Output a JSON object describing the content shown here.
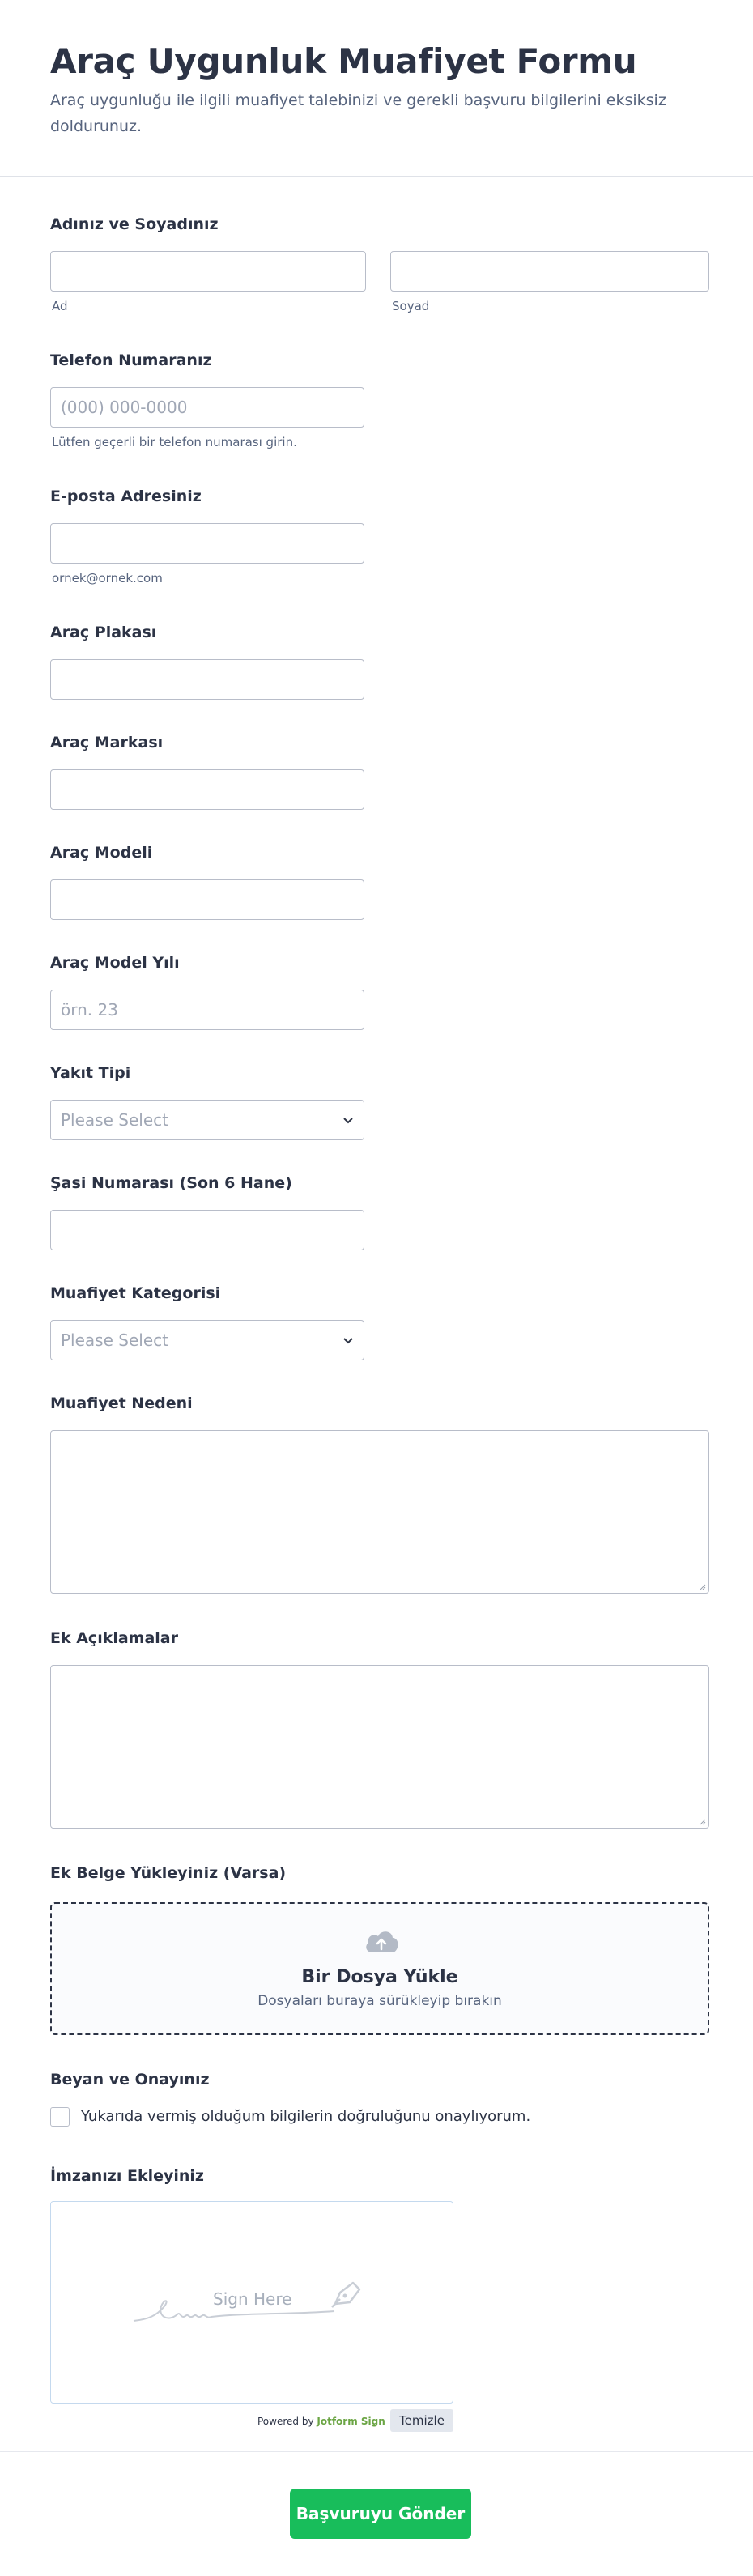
{
  "header": {
    "title": "Araç Uygunluk Muafiyet Formu",
    "subtitle": "Araç uygunluğu ile ilgili muafiyet talebinizi ve gerekli başvuru bilgilerini eksiksiz doldurunuz."
  },
  "fields": {
    "name": {
      "label": "Adınız ve Soyadınız",
      "first_sub": "Ad",
      "last_sub": "Soyad",
      "first_value": "",
      "last_value": ""
    },
    "phone": {
      "label": "Telefon Numaranız",
      "placeholder": "(000) 000-0000",
      "sub": "Lütfen geçerli bir telefon numarası girin."
    },
    "email": {
      "label": "E-posta Adresiniz",
      "sub": "ornek@ornek.com",
      "value": ""
    },
    "plate": {
      "label": "Araç Plakası",
      "value": ""
    },
    "brand": {
      "label": "Araç Markası",
      "value": ""
    },
    "model": {
      "label": "Araç Modeli",
      "value": ""
    },
    "year": {
      "label": "Araç Model Yılı",
      "placeholder": "örn. 23"
    },
    "fuel": {
      "label": "Yakıt Tipi",
      "selected": "Please Select"
    },
    "chassis": {
      "label": "Şasi Numarası (Son 6 Hane)",
      "value": ""
    },
    "category": {
      "label": "Muafiyet Kategorisi",
      "selected": "Please Select"
    },
    "reason": {
      "label": "Muafiyet Nedeni",
      "value": ""
    },
    "notes": {
      "label": "Ek Açıklamalar",
      "value": ""
    },
    "upload": {
      "label": "Ek Belge Yükleyiniz (Varsa)",
      "title": "Bir Dosya Yükle",
      "hint": "Dosyaları buraya sürükleyip bırakın"
    },
    "consent": {
      "label": "Beyan ve Onayınız",
      "text": "Yukarıda vermiş olduğum bilgilerin doğruluğunu onaylıyorum."
    },
    "signature": {
      "label": "İmzanızı Ekleyiniz",
      "placeholder": "Sign Here",
      "powered_prefix": "Powered by",
      "powered_brand": "Jotform Sign",
      "clear_label": "Temizle"
    }
  },
  "submit_label": "Başvuruyu Gönder",
  "colors": {
    "accent": "#18bd5b",
    "text": "#2c3345",
    "muted": "#57647e",
    "border": "#b8bdc9"
  },
  "icons": {
    "select": "chevron-down-icon",
    "upload": "cloud-upload-icon",
    "signature": "pen-icon"
  }
}
